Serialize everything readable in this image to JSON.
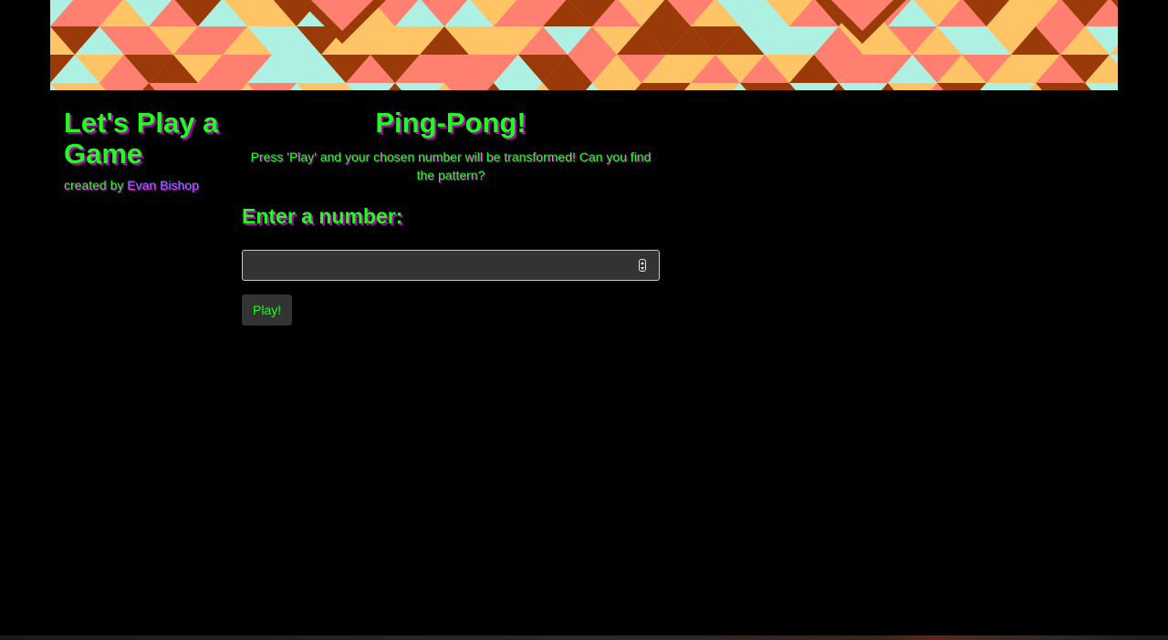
{
  "sidebar": {
    "title": "Let's Play a Game",
    "credit_prefix": "created by ",
    "author_link": "Evan Bishop"
  },
  "main": {
    "title": "Ping-Pong!",
    "intro": "Press 'Play' and your chosen number will be transformed! Can you find the pattern?",
    "prompt": "Enter a number:",
    "number_input": {
      "value": "",
      "placeholder": ""
    },
    "play_button": "Play!"
  },
  "colors": {
    "heading_text": "#1cff1c",
    "text_shadow": "#b300b3",
    "link": "#6f7bff",
    "background": "#000000",
    "control_bg": "#333333",
    "banner_palette": [
      "#ff8070",
      "#ffc466",
      "#aef0e2",
      "#9a3a08"
    ]
  },
  "icons": {
    "banner": "geometric-triangle-pattern",
    "spinner": "number-spinner-arrows"
  }
}
